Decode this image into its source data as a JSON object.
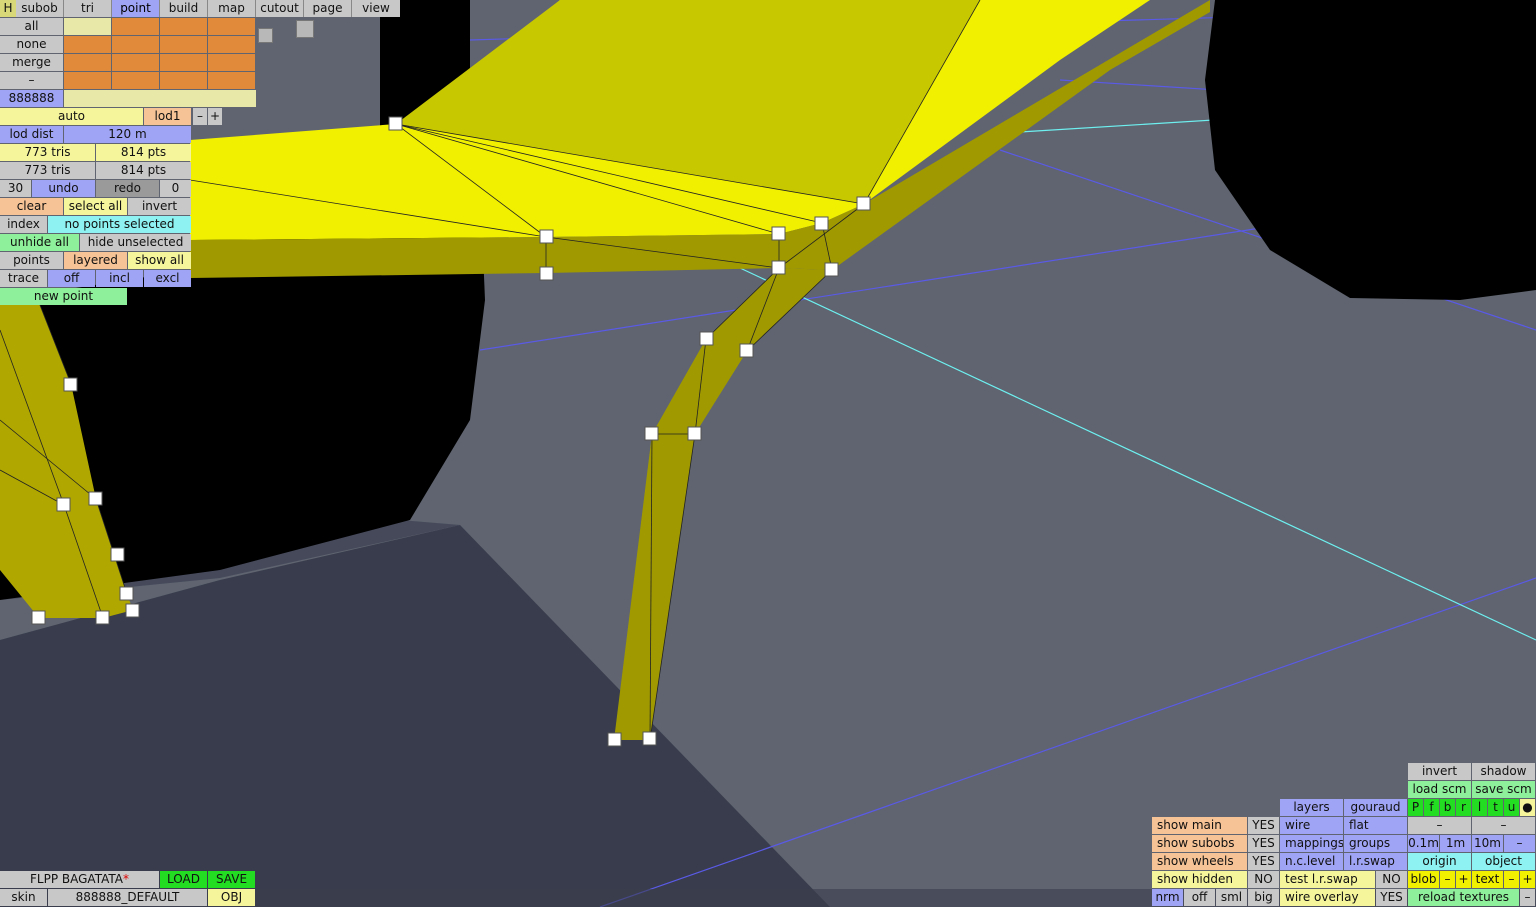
{
  "menu": {
    "h_label": "H",
    "tabs": [
      "subob",
      "tri",
      "point",
      "build",
      "map",
      "cutout",
      "page",
      "view"
    ],
    "active_tab": "point"
  },
  "left_panel": {
    "sel_all": "all",
    "sel_none": "none",
    "merge": "merge",
    "minus": "–",
    "id_label": "888888",
    "auto": "auto",
    "lod": "lod1",
    "lod_minus": "–",
    "lod_plus": "+",
    "lod_dist_label": "lod dist",
    "lod_dist_value": "120 m",
    "tris_a": "773 tris",
    "pts_a": "814 pts",
    "tris_b": "773 tris",
    "pts_b": "814 pts",
    "undo_count": "30",
    "undo": "undo",
    "redo": "redo",
    "redo_count": "0",
    "clear": "clear",
    "select_all": "select all",
    "invert": "invert",
    "index": "index",
    "selection_status": "no points selected",
    "unhide_all": "unhide all",
    "hide_unselected": "hide unselected",
    "points": "points",
    "layered": "layered",
    "show_all": "show all",
    "trace": "trace",
    "trace_off": "off",
    "incl": "incl",
    "excl": "excl",
    "new_point": "new point"
  },
  "bottom_left": {
    "car_name": "FLPP BAGATATA",
    "modified_mark": "*",
    "load": "LOAD",
    "save": "SAVE",
    "skin": "skin",
    "skin_value": "888888_DEFAULT",
    "obj": "OBJ"
  },
  "right_panel": {
    "invert": "invert",
    "shadow": "shadow",
    "load_scm": "load scm",
    "save_scm": "save scm",
    "layers": "layers",
    "gouraud": "gouraud",
    "flags": [
      "P",
      "f",
      "b",
      "r",
      "l",
      "t",
      "u",
      "●"
    ],
    "show_main": "show main",
    "show_main_val": "YES",
    "wire": "wire",
    "flat": "flat",
    "dash1": "–",
    "dash2": "–",
    "show_subobs": "show subobs",
    "show_subobs_val": "YES",
    "mappings": "mappings",
    "groups": "groups",
    "grid_01": "0.1m",
    "grid_1": "1m",
    "grid_10": "10m",
    "grid_minus": "–",
    "show_wheels": "show wheels",
    "show_wheels_val": "YES",
    "nc_level": "n.c.level",
    "lr_swap": "l.r.swap",
    "origin": "origin",
    "object": "object",
    "show_hidden": "show hidden",
    "show_hidden_val": "NO",
    "test_lr_swap": "test l.r.swap",
    "test_lr_swap_val": "NO",
    "blob": "blob",
    "blob_minus": "–",
    "blob_plus": "+",
    "text": "text",
    "text_minus": "–",
    "text_plus": "+",
    "nrm": "nrm",
    "off": "off",
    "sml": "sml",
    "big": "big",
    "wire_overlay": "wire overlay",
    "wire_overlay_val": "YES",
    "reload_textures": "reload textures",
    "reload_minus": "–"
  },
  "colors": {
    "background": "#5f6470",
    "wing_yellow": "#f0f000",
    "strut_olive": "#a09a00",
    "tyre_black": "#000000",
    "guide_blue": "#5a5ae6",
    "guide_cyan": "#6ef0f0"
  }
}
